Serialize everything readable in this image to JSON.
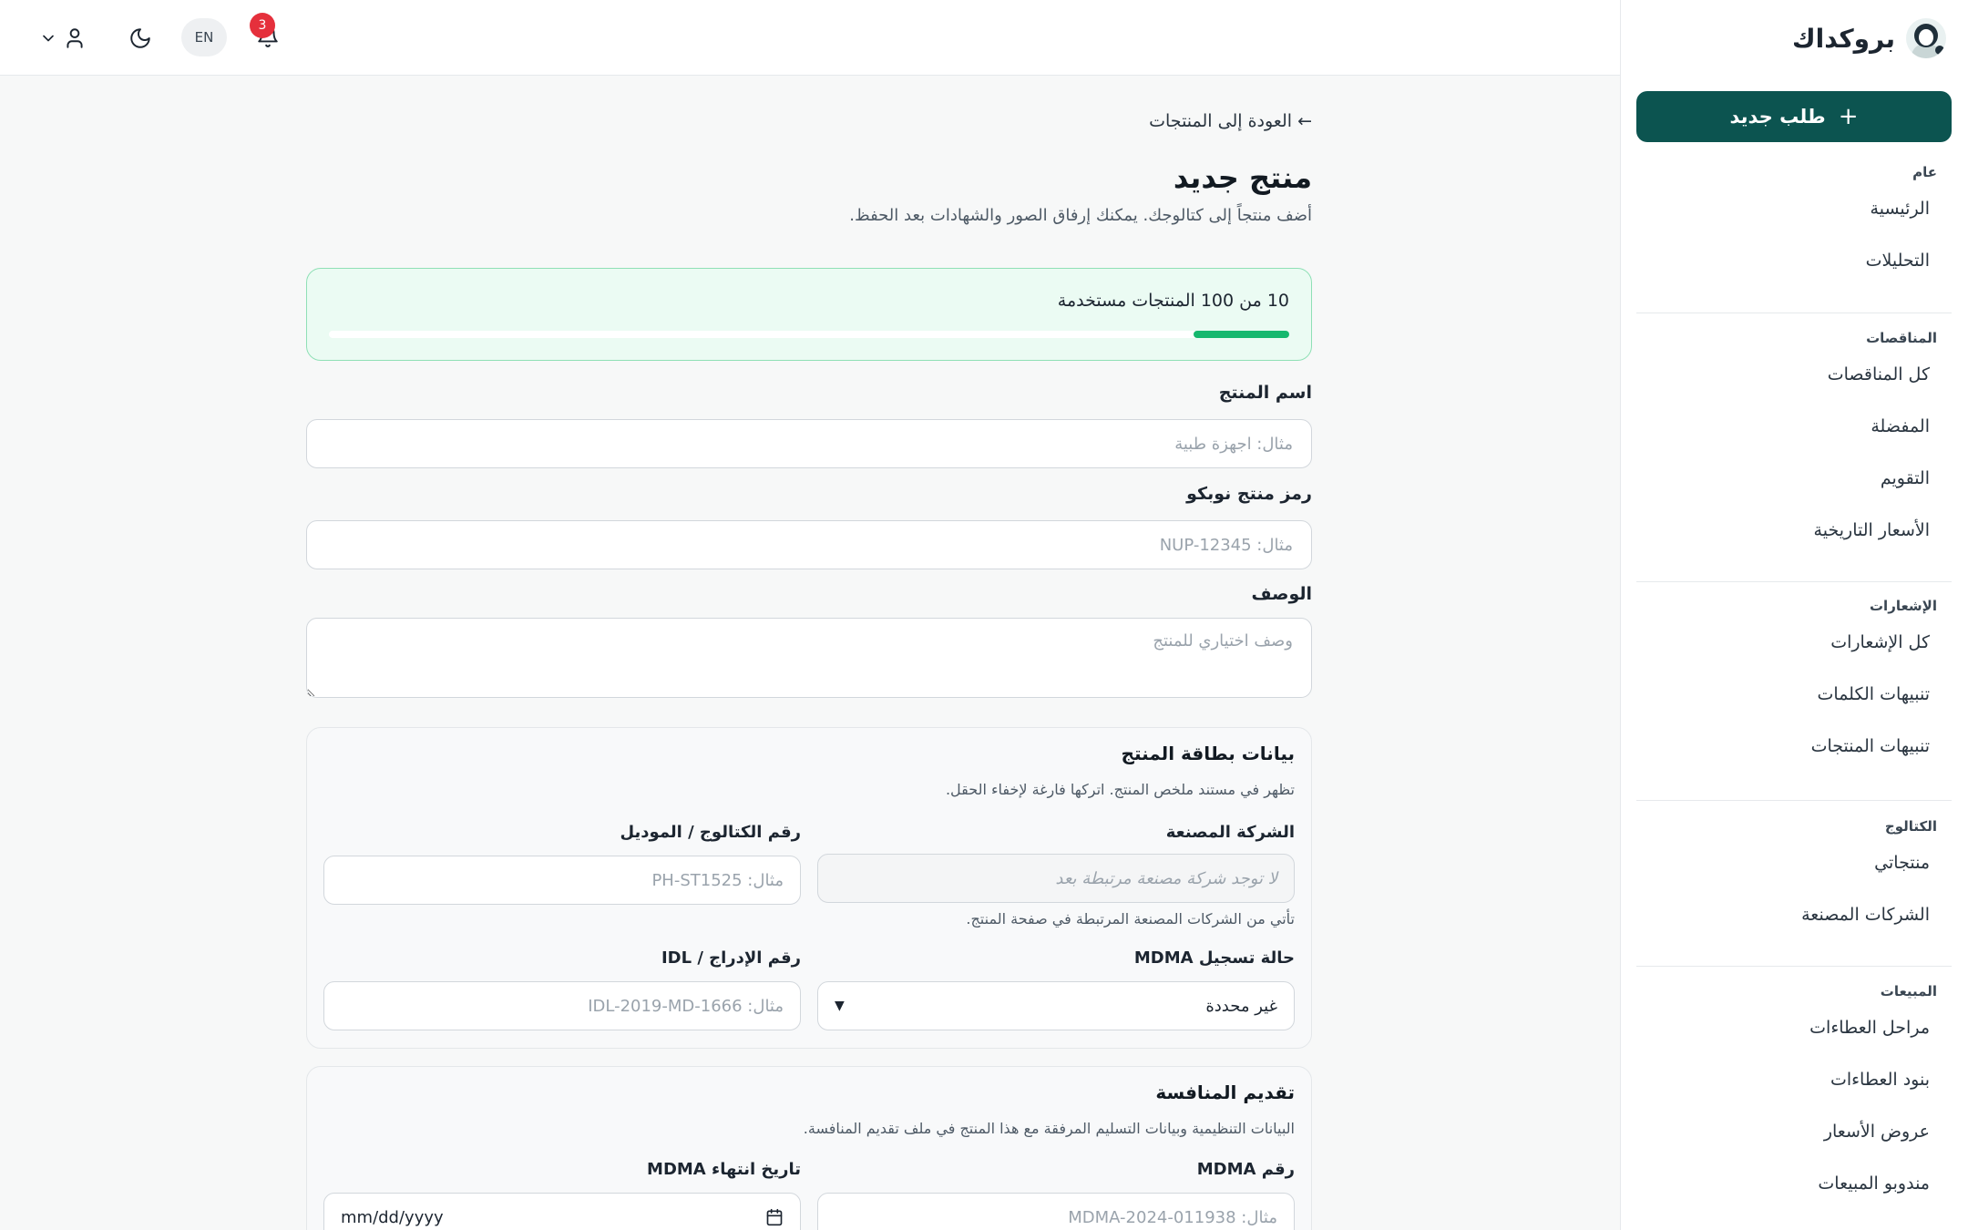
{
  "brand": {
    "name": "بروكداك"
  },
  "sidebar": {
    "new_request_label": "طلب جديد",
    "groups": [
      {
        "title": "عام",
        "items": [
          {
            "label": "الرئيسية"
          },
          {
            "label": "التحليلات"
          }
        ]
      },
      {
        "title": "المناقصات",
        "items": [
          {
            "label": "كل المناقصات"
          },
          {
            "label": "المفضلة"
          },
          {
            "label": "التقويم"
          },
          {
            "label": "الأسعار التاريخية"
          }
        ]
      },
      {
        "title": "الإشعارات",
        "items": [
          {
            "label": "كل الإشعارات"
          },
          {
            "label": "تنبيهات الكلمات"
          },
          {
            "label": "تنبيهات المنتجات"
          }
        ]
      },
      {
        "title": "الكتالوج",
        "items": [
          {
            "label": "منتجاتي"
          },
          {
            "label": "الشركات المصنعة"
          }
        ]
      },
      {
        "title": "المبيعات",
        "items": [
          {
            "label": "مراحل العطاءات"
          },
          {
            "label": "بنود العطاءات"
          },
          {
            "label": "عروض الأسعار"
          },
          {
            "label": "مندوبو المبيعات"
          }
        ]
      }
    ]
  },
  "topbar": {
    "notification_count": "3",
    "language_label": "EN"
  },
  "page": {
    "back_link": "← العودة إلى المنتجات",
    "title": "منتج جديد",
    "subtitle": "أضف منتجاً إلى كتالوجك. يمكنك إرفاق الصور والشهادات بعد الحفظ."
  },
  "usage": {
    "text": "10 من 100 المنتجات مستخدمة",
    "used": 10,
    "limit": 100
  },
  "form": {
    "product_name_label": "اسم المنتج",
    "product_name_placeholder": "مثال: اجهزة طبية",
    "nupco_code_label": "رمز منتج نوبكو",
    "nupco_code_placeholder": "مثال: NUP-12345",
    "description_label": "الوصف",
    "description_placeholder": "وصف اختياري للمنتج"
  },
  "product_card": {
    "title": "بيانات بطاقة المنتج",
    "description": "تظهر في مستند ملخص المنتج. اتركها فارغة لإخفاء الحقل.",
    "manufacturer_label": "الشركة المصنعة",
    "manufacturer_placeholder": "لا توجد شركة مصنعة مرتبطة بعد",
    "manufacturer_hint": "تأتي من الشركات المصنعة المرتبطة في صفحة المنتج.",
    "catalog_label": "رقم الكتالوج / الموديل",
    "catalog_placeholder": "مثال: PH-ST1525",
    "mdma_status_label": "حالة تسجيل MDMA",
    "mdma_status_value": "غير محددة",
    "idl_label": "رقم الإدراج / IDL",
    "idl_placeholder": "مثال: IDL-2019-MD-1666"
  },
  "tender_card": {
    "title": "تقديم المنافسة",
    "description": "البيانات التنظيمية وبيانات التسليم المرفقة مع هذا المنتج في ملف تقديم المنافسة.",
    "mdma_number_label": "رقم MDMA",
    "mdma_number_placeholder": "مثال: MDMA-2024-011938",
    "mdma_expiry_label": "تاريخ انتهاء MDMA",
    "mdma_expiry_placeholder": "mm/dd/yyyy"
  },
  "colors": {
    "primary": "#0c5450",
    "progress": "#16b86e",
    "badge": "#e5303c"
  }
}
